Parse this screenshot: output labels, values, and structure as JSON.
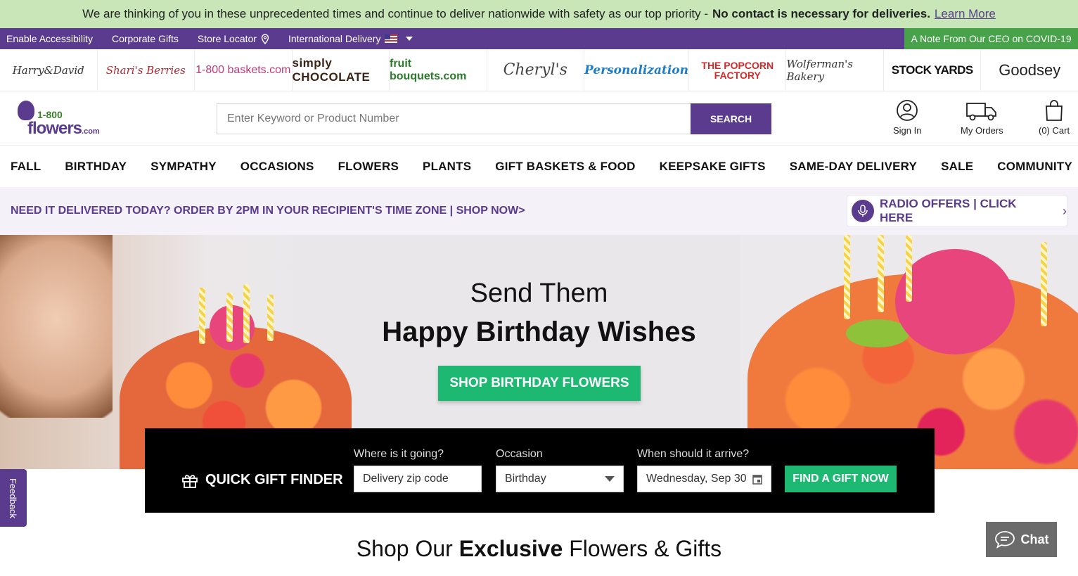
{
  "announcement": {
    "text": "We are thinking of you in these unprecedented times and continue to deliver nationwide with safety as our top priority -",
    "bold_text": "No contact is necessary for deliveries.",
    "link": "Learn More"
  },
  "utility": {
    "accessibility": "Enable Accessibility",
    "corporate": "Corporate Gifts",
    "store_locator": "Store Locator",
    "international": "International Delivery",
    "ceo_note": "A Note From Our CEO on COVID-19"
  },
  "brands": [
    "Harry&David",
    "Shari's Berries",
    "1-800 baskets.com",
    "simply CHOCOLATE",
    "fruit bouquets.com",
    "Cheryl's",
    "Personalization",
    "THE POPCORN FACTORY",
    "Wolferman's Bakery",
    "STOCK YARDS",
    "Goodsey"
  ],
  "header": {
    "logo_number": "1-800",
    "logo_word": "flowers",
    "logo_suffix": ".com",
    "search_placeholder": "Enter Keyword or Product Number",
    "search_button": "SEARCH",
    "sign_in": "Sign In",
    "my_orders": "My Orders",
    "cart": "(0) Cart"
  },
  "nav": [
    "FALL",
    "BIRTHDAY",
    "SYMPATHY",
    "OCCASIONS",
    "FLOWERS",
    "PLANTS",
    "GIFT BASKETS & FOOD",
    "KEEPSAKE GIFTS",
    "SAME-DAY DELIVERY",
    "SALE",
    "COMMUNITY"
  ],
  "promo": {
    "text": "NEED IT DELIVERED TODAY? ORDER BY 2PM IN YOUR RECIPIENT'S TIME ZONE | SHOP NOW>",
    "radio": "RADIO OFFERS | CLICK HERE"
  },
  "hero": {
    "line1": "Send Them",
    "line2": "Happy Birthday Wishes",
    "cta": "SHOP BIRTHDAY FLOWERS"
  },
  "finder": {
    "title": "QUICK GIFT FINDER",
    "zip_label": "Where is it going?",
    "zip_placeholder": "Delivery zip code",
    "occasion_label": "Occasion",
    "occasion_value": "Birthday",
    "date_label": "When should it arrive?",
    "date_value": "Wednesday, Sep 30",
    "button": "FIND A GIFT NOW"
  },
  "feedback": "Feedback",
  "section_title": {
    "pre": "Shop Our",
    "bold": "Exclusive",
    "post": "Flowers & Gifts"
  },
  "chat": "Chat"
}
